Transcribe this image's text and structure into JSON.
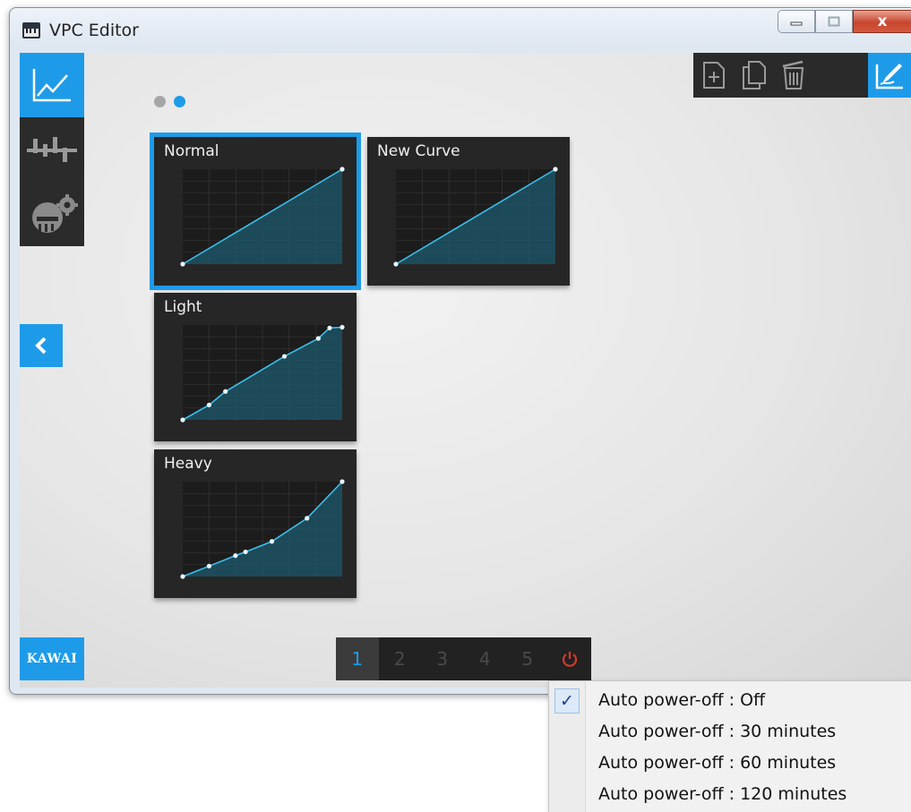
{
  "window": {
    "title": "VPC Editor",
    "controls": {
      "minimize": "minimize",
      "maximize": "maximize",
      "close": "x"
    }
  },
  "sidebar": {
    "items": [
      {
        "name": "touch-curve",
        "icon": "curve-graph-icon",
        "active": true
      },
      {
        "name": "voicing",
        "icon": "voicing-bars-icon",
        "active": false
      },
      {
        "name": "settings",
        "icon": "piano-gear-icon",
        "active": false
      }
    ],
    "back_icon": "chevron-left-icon",
    "brand": "KAWAI"
  },
  "toolbar": {
    "items": [
      "new-file-icon",
      "copy-icon",
      "delete-icon",
      "edit-curve-icon"
    ]
  },
  "pages": {
    "count": 2,
    "current": 2
  },
  "curves": [
    {
      "title": "Normal",
      "selected": true,
      "points": [
        [
          0,
          0
        ],
        [
          127,
          127
        ]
      ]
    },
    {
      "title": "New Curve",
      "selected": false,
      "points": [
        [
          0,
          0
        ],
        [
          127,
          127
        ]
      ]
    },
    {
      "title": "Light",
      "selected": false,
      "points": [
        [
          0,
          0
        ],
        [
          21,
          20
        ],
        [
          34,
          38
        ],
        [
          81,
          85
        ],
        [
          108,
          109
        ],
        [
          117,
          123
        ],
        [
          127,
          124
        ]
      ]
    },
    {
      "title": "Heavy",
      "selected": false,
      "points": [
        [
          0,
          0
        ],
        [
          21,
          14
        ],
        [
          42,
          28
        ],
        [
          50,
          33
        ],
        [
          71,
          47
        ],
        [
          99,
          78
        ],
        [
          127,
          127
        ]
      ]
    }
  ],
  "memory_bar": {
    "slots": [
      "1",
      "2",
      "3",
      "4",
      "5"
    ],
    "active": "1",
    "power_icon": "power-icon"
  },
  "context_menu": {
    "items": [
      {
        "label": "Auto power-off : Off",
        "checked": true
      },
      {
        "label": "Auto power-off : 30 minutes",
        "checked": false
      },
      {
        "label": "Auto power-off : 60 minutes",
        "checked": false
      },
      {
        "label": "Auto power-off : 120 minutes",
        "checked": false
      }
    ],
    "check_mark": "✓"
  },
  "colors": {
    "accent": "#1e9be8",
    "panel": "#262626",
    "power": "#d23a2a"
  }
}
